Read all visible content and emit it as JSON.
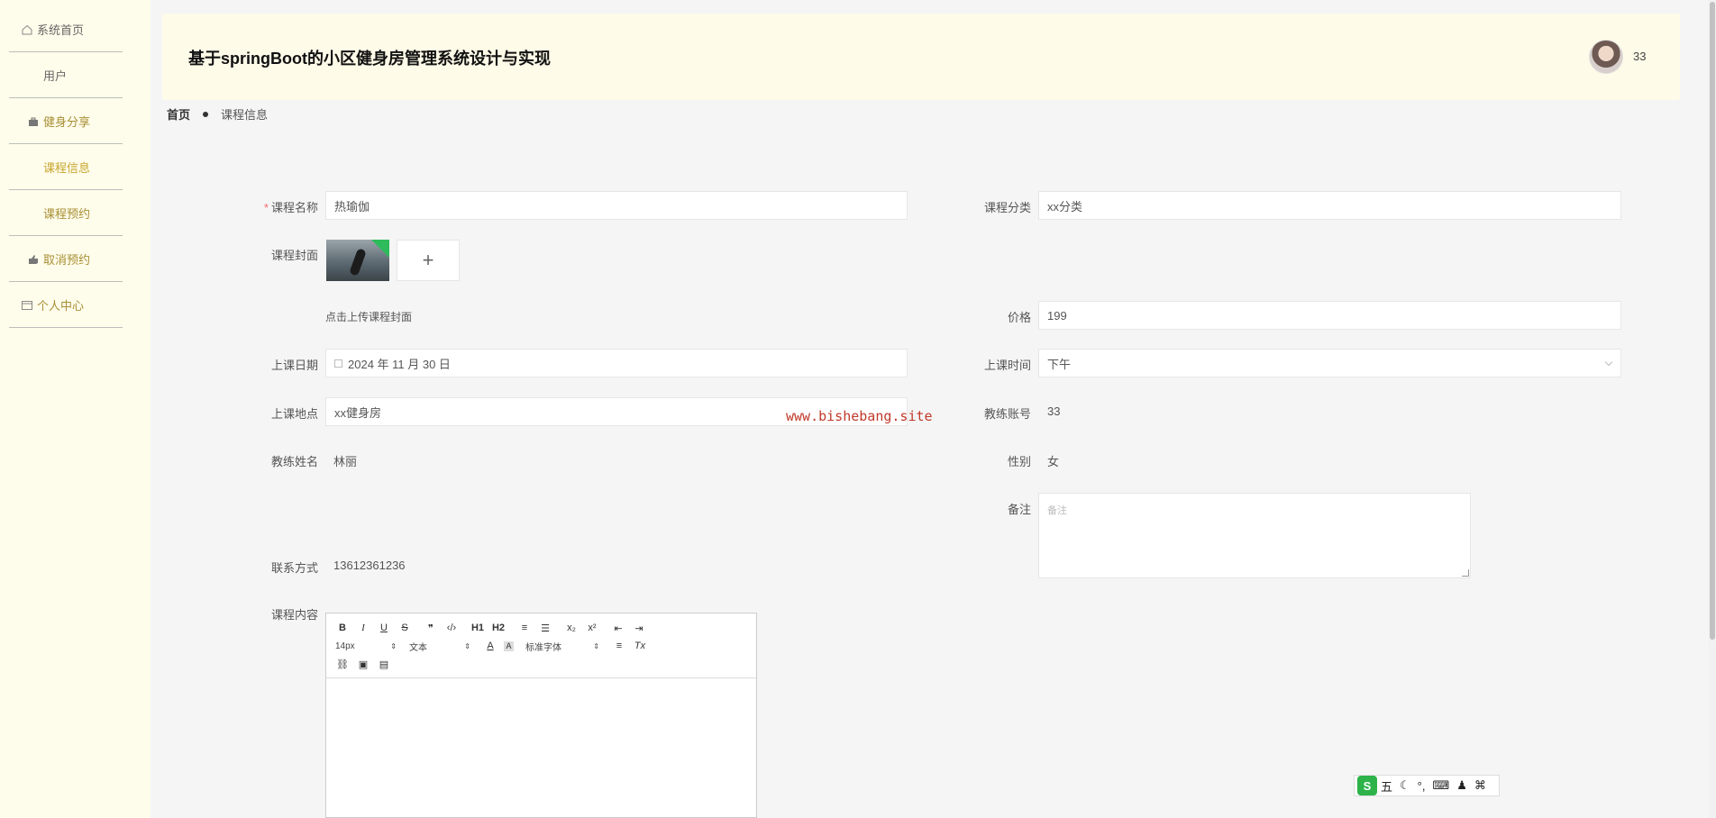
{
  "sidebar": {
    "items": [
      {
        "label": "系统首页",
        "icon": "home-icon",
        "active": false
      },
      {
        "label": "用户",
        "icon": "grid-icon",
        "active": false
      },
      {
        "label": "健身分享",
        "icon": "briefcase-icon",
        "active": false
      },
      {
        "label": "课程信息",
        "icon": "grid-icon",
        "active": true
      },
      {
        "label": "课程预约",
        "icon": "grid-icon",
        "active": false
      },
      {
        "label": "取消预约",
        "icon": "thumb-icon",
        "active": false
      },
      {
        "label": "个人中心",
        "icon": "card-icon",
        "active": false
      }
    ],
    "accent_color": "#c8a632"
  },
  "header": {
    "title": "基于springBoot的小区健身房管理系统设计与实现",
    "username": "33"
  },
  "breadcrumb": {
    "home": "首页",
    "current": "课程信息"
  },
  "form": {
    "course_name_label": "课程名称",
    "course_name_value": "热瑜伽",
    "course_category_label": "课程分类",
    "course_category_value": "xx分类",
    "cover_label": "课程封面",
    "upload_plus": "+",
    "upload_tip": "点击上传课程封面",
    "price_label": "价格",
    "price_value": "199",
    "date_label": "上课日期",
    "date_value": "2024 年 11 月 30 日",
    "time_label": "上课时间",
    "time_value": "下午",
    "place_label": "上课地点",
    "place_value": "xx健身房",
    "coach_account_label": "教练账号",
    "coach_account_value": "33",
    "coach_name_label": "教练姓名",
    "coach_name_value": "林丽",
    "gender_label": "性别",
    "gender_value": "女",
    "remark_label": "备注",
    "remark_placeholder": "备注",
    "contact_label": "联系方式",
    "contact_value": "13612361236",
    "content_label": "课程内容"
  },
  "editor": {
    "row1": [
      "B",
      "I",
      "U",
      "S",
      "❞",
      "‹/›",
      "H1",
      "H2",
      "≡",
      "☰",
      "x₂",
      "x²",
      "⇤",
      "⇥"
    ],
    "font_size": "14px",
    "block_type": "文本",
    "font_family": "标准字体"
  },
  "watermark": "www.bishebang.site",
  "ime": {
    "logo": "S",
    "mode": "五"
  }
}
